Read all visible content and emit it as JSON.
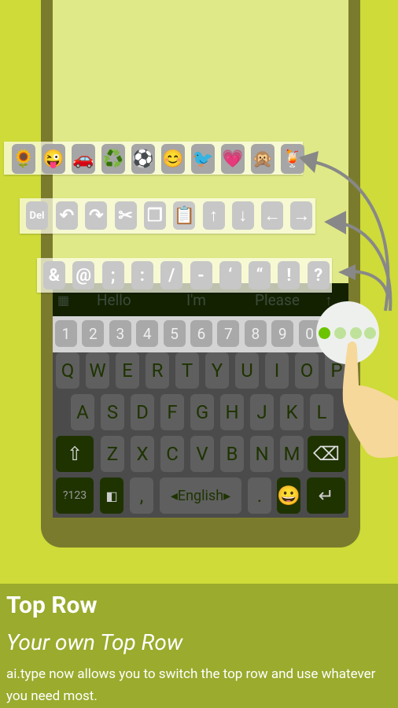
{
  "suggestions": [
    "Hello",
    "I'm",
    "Please"
  ],
  "emoji_row": [
    "🌻",
    "😜",
    "🚗",
    "♻️",
    "⚽",
    "😊",
    "🐦",
    "💗",
    "🙊",
    "🍹"
  ],
  "action_row": {
    "del_label": "Del",
    "icons": [
      "undo-icon",
      "redo-icon",
      "cut-icon",
      "copy-icon",
      "paste-icon",
      "arrow-up-icon",
      "arrow-down-icon",
      "arrow-left-icon",
      "arrow-right-icon"
    ],
    "glyphs": [
      "↶",
      "↷",
      "✂",
      "❐",
      "📋",
      "↑",
      "↓",
      "←",
      "→"
    ]
  },
  "symbol_row": [
    "&",
    "@",
    ";",
    ":",
    "/",
    "-",
    "‘",
    "“",
    "!",
    "?"
  ],
  "number_row": [
    "1",
    "2",
    "3",
    "4",
    "5",
    "6",
    "7",
    "8",
    "9",
    "0"
  ],
  "keyboard": {
    "row1": [
      "Q",
      "W",
      "E",
      "R",
      "T",
      "Y",
      "U",
      "I",
      "O",
      "P"
    ],
    "row2": [
      "A",
      "S",
      "D",
      "F",
      "G",
      "H",
      "J",
      "K",
      "L"
    ],
    "row3": [
      "Z",
      "X",
      "C",
      "V",
      "B",
      "N",
      "M"
    ],
    "sym_label": "?123",
    "comma": ",",
    "space_label": "English",
    "period": "."
  },
  "colors": {
    "background": "#cedb38",
    "phone": "#7b7b2e",
    "accent": "#6cc400"
  },
  "footer": {
    "title": "Top Row",
    "subtitle": "Your own Top Row",
    "description": "ai.type now allows you to switch the top row and use whatever you need most."
  }
}
